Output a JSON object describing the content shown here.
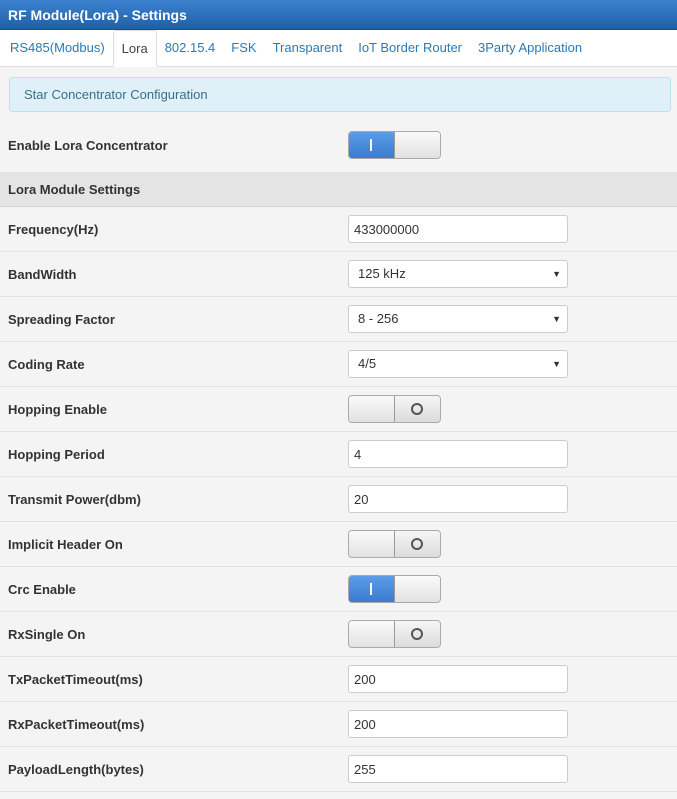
{
  "title": "RF Module(Lora) - Settings",
  "tabs": [
    {
      "label": "RS485(Modbus)"
    },
    {
      "label": "Lora"
    },
    {
      "label": "802.15.4"
    },
    {
      "label": "FSK"
    },
    {
      "label": "Transparent"
    },
    {
      "label": "IoT Border Router"
    },
    {
      "label": "3Party Application"
    }
  ],
  "active_tab": "Lora",
  "alert": "Star Concentrator Configuration",
  "enable_concentrator": {
    "label": "Enable Lora Concentrator",
    "state": "on"
  },
  "section_header": "Lora Module Settings",
  "fields": {
    "frequency": {
      "label": "Frequency(Hz)",
      "value": "433000000"
    },
    "bandwidth": {
      "label": "BandWidth",
      "value": "125 kHz"
    },
    "spreading_factor": {
      "label": "Spreading Factor",
      "value": "8 - 256"
    },
    "coding_rate": {
      "label": "Coding Rate",
      "value": "4/5"
    },
    "hopping_enable": {
      "label": "Hopping Enable",
      "state": "off"
    },
    "hopping_period": {
      "label": "Hopping Period",
      "value": "4"
    },
    "transmit_power": {
      "label": "Transmit Power(dbm)",
      "value": "20"
    },
    "implicit_header": {
      "label": "Implicit Header On",
      "state": "off"
    },
    "crc_enable": {
      "label": "Crc Enable",
      "state": "on"
    },
    "rx_single": {
      "label": "RxSingle On",
      "state": "off"
    },
    "tx_packet_timeout": {
      "label": "TxPacketTimeout(ms)",
      "value": "200"
    },
    "rx_packet_timeout": {
      "label": "RxPacketTimeout(ms)",
      "value": "200"
    },
    "payload_length": {
      "label": "PayloadLength(bytes)",
      "value": "255"
    }
  },
  "colors": {
    "titlebar": "#1f5fa8",
    "tab_link": "#2a7ab8",
    "toggle_on": "#3a7bd0",
    "alert_bg": "#dff0f8"
  },
  "icons": {
    "toggle_on": "bar-icon",
    "toggle_off": "circle-icon",
    "select_arrow": "caret-down-icon"
  }
}
